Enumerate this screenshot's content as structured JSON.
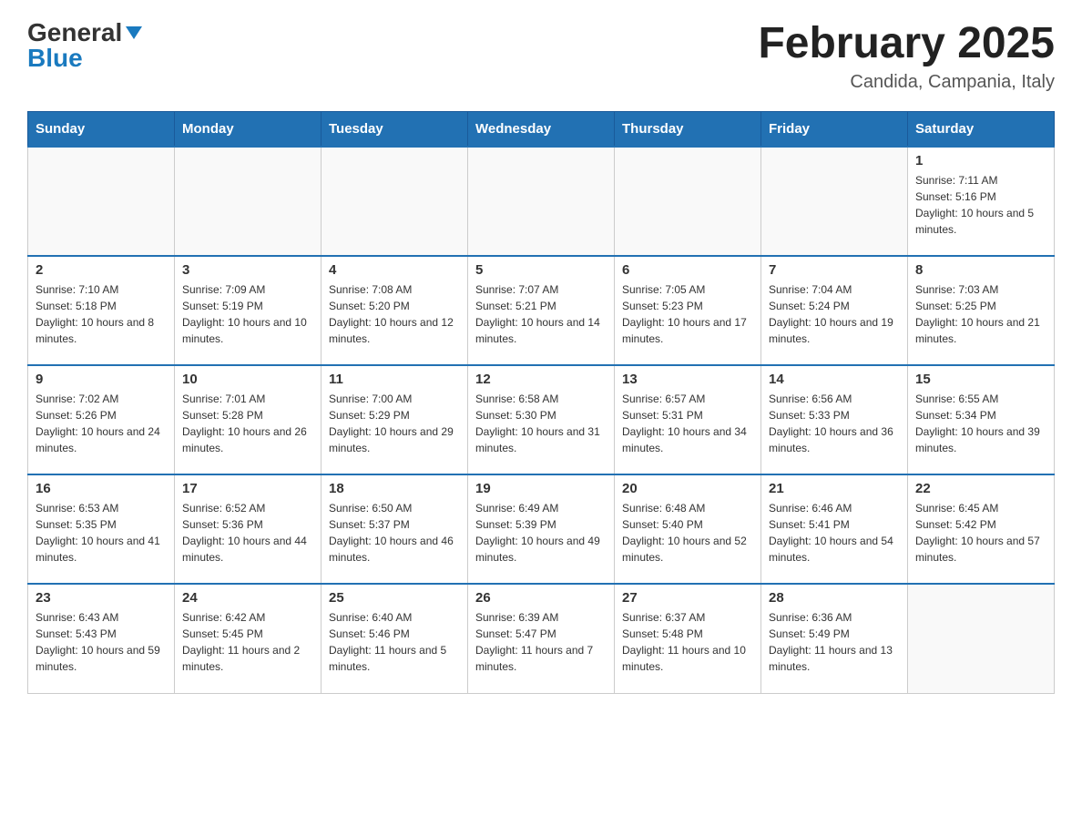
{
  "logo": {
    "general": "General",
    "blue": "Blue"
  },
  "header": {
    "title": "February 2025",
    "location": "Candida, Campania, Italy"
  },
  "days_of_week": [
    "Sunday",
    "Monday",
    "Tuesday",
    "Wednesday",
    "Thursday",
    "Friday",
    "Saturday"
  ],
  "weeks": [
    [
      {
        "day": "",
        "info": ""
      },
      {
        "day": "",
        "info": ""
      },
      {
        "day": "",
        "info": ""
      },
      {
        "day": "",
        "info": ""
      },
      {
        "day": "",
        "info": ""
      },
      {
        "day": "",
        "info": ""
      },
      {
        "day": "1",
        "info": "Sunrise: 7:11 AM\nSunset: 5:16 PM\nDaylight: 10 hours and 5 minutes."
      }
    ],
    [
      {
        "day": "2",
        "info": "Sunrise: 7:10 AM\nSunset: 5:18 PM\nDaylight: 10 hours and 8 minutes."
      },
      {
        "day": "3",
        "info": "Sunrise: 7:09 AM\nSunset: 5:19 PM\nDaylight: 10 hours and 10 minutes."
      },
      {
        "day": "4",
        "info": "Sunrise: 7:08 AM\nSunset: 5:20 PM\nDaylight: 10 hours and 12 minutes."
      },
      {
        "day": "5",
        "info": "Sunrise: 7:07 AM\nSunset: 5:21 PM\nDaylight: 10 hours and 14 minutes."
      },
      {
        "day": "6",
        "info": "Sunrise: 7:05 AM\nSunset: 5:23 PM\nDaylight: 10 hours and 17 minutes."
      },
      {
        "day": "7",
        "info": "Sunrise: 7:04 AM\nSunset: 5:24 PM\nDaylight: 10 hours and 19 minutes."
      },
      {
        "day": "8",
        "info": "Sunrise: 7:03 AM\nSunset: 5:25 PM\nDaylight: 10 hours and 21 minutes."
      }
    ],
    [
      {
        "day": "9",
        "info": "Sunrise: 7:02 AM\nSunset: 5:26 PM\nDaylight: 10 hours and 24 minutes."
      },
      {
        "day": "10",
        "info": "Sunrise: 7:01 AM\nSunset: 5:28 PM\nDaylight: 10 hours and 26 minutes."
      },
      {
        "day": "11",
        "info": "Sunrise: 7:00 AM\nSunset: 5:29 PM\nDaylight: 10 hours and 29 minutes."
      },
      {
        "day": "12",
        "info": "Sunrise: 6:58 AM\nSunset: 5:30 PM\nDaylight: 10 hours and 31 minutes."
      },
      {
        "day": "13",
        "info": "Sunrise: 6:57 AM\nSunset: 5:31 PM\nDaylight: 10 hours and 34 minutes."
      },
      {
        "day": "14",
        "info": "Sunrise: 6:56 AM\nSunset: 5:33 PM\nDaylight: 10 hours and 36 minutes."
      },
      {
        "day": "15",
        "info": "Sunrise: 6:55 AM\nSunset: 5:34 PM\nDaylight: 10 hours and 39 minutes."
      }
    ],
    [
      {
        "day": "16",
        "info": "Sunrise: 6:53 AM\nSunset: 5:35 PM\nDaylight: 10 hours and 41 minutes."
      },
      {
        "day": "17",
        "info": "Sunrise: 6:52 AM\nSunset: 5:36 PM\nDaylight: 10 hours and 44 minutes."
      },
      {
        "day": "18",
        "info": "Sunrise: 6:50 AM\nSunset: 5:37 PM\nDaylight: 10 hours and 46 minutes."
      },
      {
        "day": "19",
        "info": "Sunrise: 6:49 AM\nSunset: 5:39 PM\nDaylight: 10 hours and 49 minutes."
      },
      {
        "day": "20",
        "info": "Sunrise: 6:48 AM\nSunset: 5:40 PM\nDaylight: 10 hours and 52 minutes."
      },
      {
        "day": "21",
        "info": "Sunrise: 6:46 AM\nSunset: 5:41 PM\nDaylight: 10 hours and 54 minutes."
      },
      {
        "day": "22",
        "info": "Sunrise: 6:45 AM\nSunset: 5:42 PM\nDaylight: 10 hours and 57 minutes."
      }
    ],
    [
      {
        "day": "23",
        "info": "Sunrise: 6:43 AM\nSunset: 5:43 PM\nDaylight: 10 hours and 59 minutes."
      },
      {
        "day": "24",
        "info": "Sunrise: 6:42 AM\nSunset: 5:45 PM\nDaylight: 11 hours and 2 minutes."
      },
      {
        "day": "25",
        "info": "Sunrise: 6:40 AM\nSunset: 5:46 PM\nDaylight: 11 hours and 5 minutes."
      },
      {
        "day": "26",
        "info": "Sunrise: 6:39 AM\nSunset: 5:47 PM\nDaylight: 11 hours and 7 minutes."
      },
      {
        "day": "27",
        "info": "Sunrise: 6:37 AM\nSunset: 5:48 PM\nDaylight: 11 hours and 10 minutes."
      },
      {
        "day": "28",
        "info": "Sunrise: 6:36 AM\nSunset: 5:49 PM\nDaylight: 11 hours and 13 minutes."
      },
      {
        "day": "",
        "info": ""
      }
    ]
  ]
}
